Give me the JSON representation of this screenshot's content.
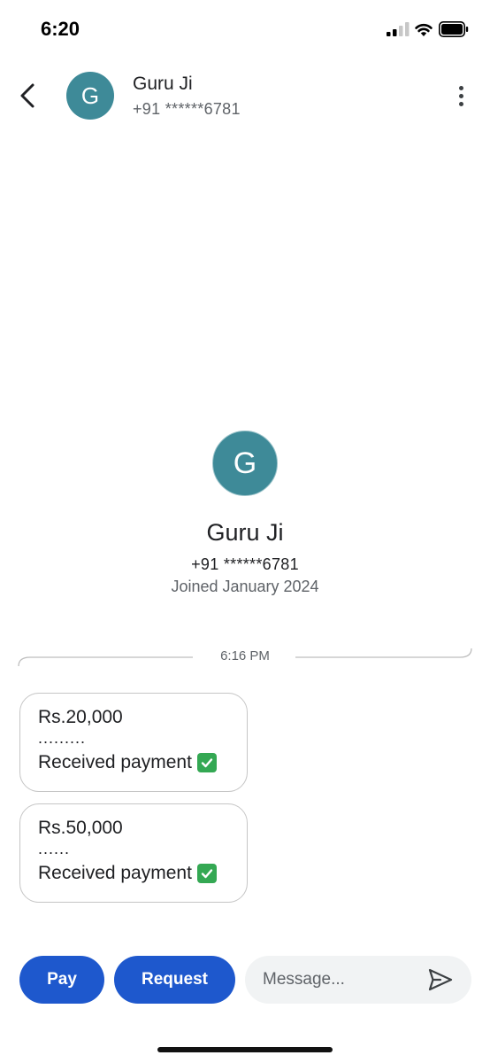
{
  "status_bar": {
    "time": "6:20"
  },
  "header": {
    "avatar_letter": "G",
    "name": "Guru Ji",
    "phone": "+91 ******6781",
    "icons": {
      "back": "chevron-left-icon",
      "more": "more-vert-icon"
    }
  },
  "profile": {
    "avatar_letter": "G",
    "name": "Guru Ji",
    "phone": "+91 ******6781",
    "joined": "Joined January 2024"
  },
  "conversation": {
    "timestamp": "6:16 PM",
    "messages": [
      {
        "amount": "Rs.20,000",
        "dots": ".........",
        "status": "Received payment"
      },
      {
        "amount": "Rs.50,000",
        "dots": "......",
        "status": "Received payment"
      }
    ]
  },
  "bottom_bar": {
    "pay_label": "Pay",
    "request_label": "Request",
    "message_placeholder": "Message...",
    "send_icon": "send-icon"
  },
  "colors": {
    "avatar": "#3e8a98",
    "primary_button": "#1e58cd",
    "check_emoji": "#34a853"
  }
}
